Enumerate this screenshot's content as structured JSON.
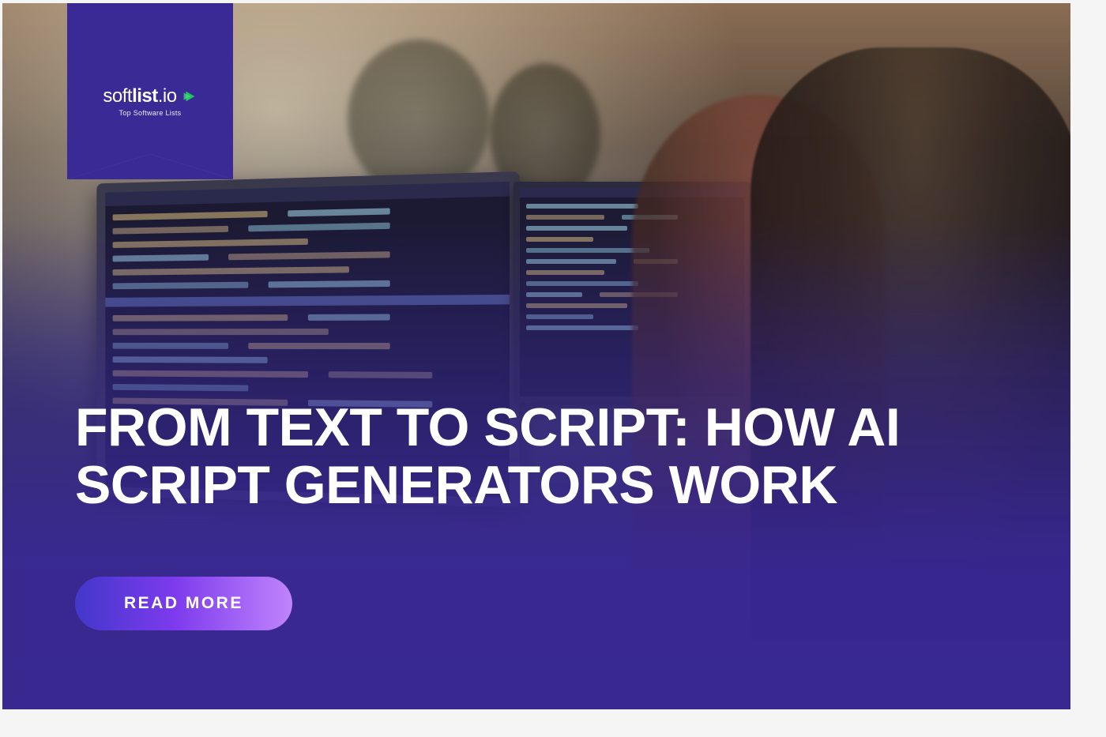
{
  "logo": {
    "brand_part1": "soft",
    "brand_part2": "list",
    "brand_domain": ".io",
    "tagline": "Top Software Lists"
  },
  "headline": "FROM TEXT TO SCRIPT: HOW AI SCRIPT GENERATORS WORK",
  "cta": {
    "label": "READ MORE"
  },
  "colors": {
    "brand_purple": "#3a2a96",
    "accent_green": "#22c55e",
    "gradient_start": "#4338ca",
    "gradient_end": "#c084fc"
  }
}
